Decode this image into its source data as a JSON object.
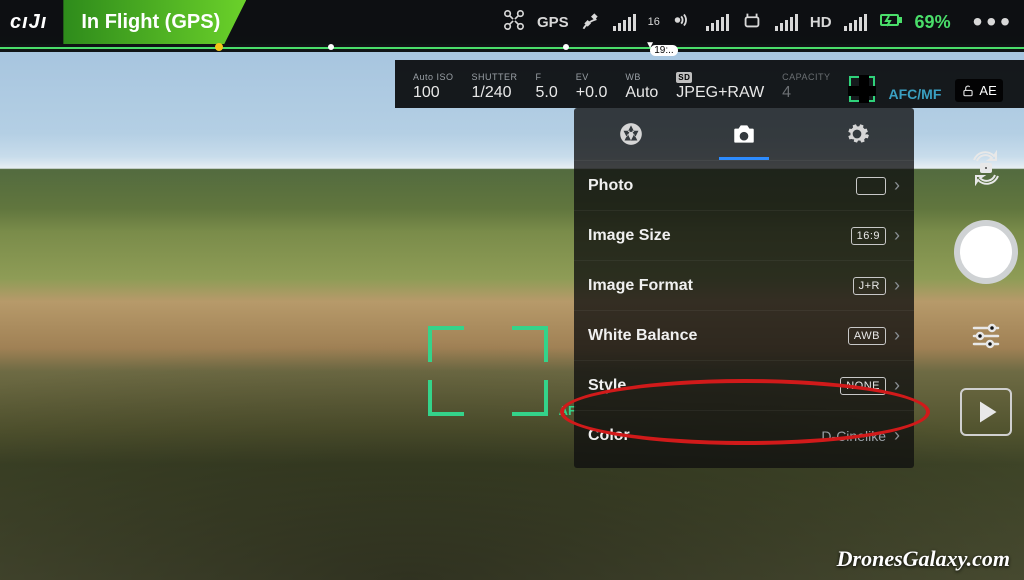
{
  "status": {
    "brand": "cıJı",
    "mode": "In Flight (GPS)",
    "gps_label": "GPS",
    "sat_count": "16",
    "hd_label": "HD",
    "battery_pct": "69%",
    "timeline_time": "19:.."
  },
  "exposure": {
    "iso_label": "Auto ISO",
    "iso_value": "100",
    "shutter_label": "SHUTTER",
    "shutter_value": "1/240",
    "f_label": "F",
    "f_value": "5.0",
    "ev_label": "EV",
    "ev_value": "+0.0",
    "wb_label": "WB",
    "wb_value": "Auto",
    "sd_label": "SD",
    "format_value": "JPEG+RAW",
    "capacity_label": "CAPACITY",
    "capacity_value": "4",
    "afcmf": "AFC/MF",
    "ae_lock": "AE"
  },
  "panel": {
    "rows": [
      {
        "label": "Photo",
        "value": "",
        "badge": "icon"
      },
      {
        "label": "Image Size",
        "value": "16:9",
        "badge": "text"
      },
      {
        "label": "Image Format",
        "value": "J+R",
        "badge": "text"
      },
      {
        "label": "White Balance",
        "value": "AWB",
        "badge": "text"
      },
      {
        "label": "Style",
        "value": "NONE",
        "badge": "text"
      },
      {
        "label": "Color",
        "value": "D-Cinelike",
        "badge": "plain"
      }
    ]
  },
  "af_label": "AF",
  "watermark": "DronesGalaxy.com"
}
